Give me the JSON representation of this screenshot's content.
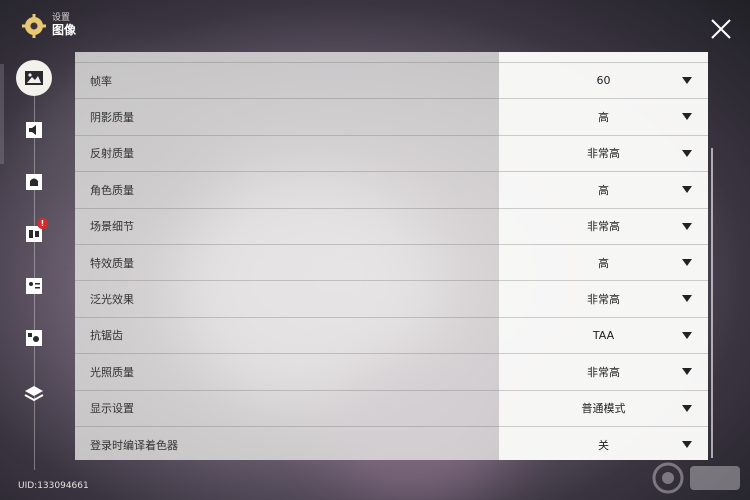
{
  "header": {
    "section": "设置",
    "title": "图像"
  },
  "nav": {
    "items": [
      {
        "id": "graphics",
        "icon": "image-icon",
        "active": true
      },
      {
        "id": "audio",
        "icon": "speaker-icon",
        "active": false
      },
      {
        "id": "notifications",
        "icon": "bell-icon",
        "active": false
      },
      {
        "id": "account",
        "icon": "account-card-icon",
        "active": false,
        "badge": "!"
      },
      {
        "id": "profile",
        "icon": "id-card-icon",
        "active": false
      },
      {
        "id": "controls",
        "icon": "gear-card-icon",
        "active": false
      },
      {
        "id": "other",
        "icon": "layers-icon",
        "active": false
      }
    ]
  },
  "settings": {
    "rows": [
      {
        "label": "帧率",
        "value": "60"
      },
      {
        "label": "阴影质量",
        "value": "高"
      },
      {
        "label": "反射质量",
        "value": "非常高"
      },
      {
        "label": "角色质量",
        "value": "高"
      },
      {
        "label": "场景细节",
        "value": "非常高"
      },
      {
        "label": "特效质量",
        "value": "高"
      },
      {
        "label": "泛光效果",
        "value": "非常高"
      },
      {
        "label": "抗锯齿",
        "value": "TAA"
      },
      {
        "label": "光照质量",
        "value": "非常高"
      },
      {
        "label": "显示设置",
        "value": "普通模式"
      },
      {
        "label": "登录时编译着色器",
        "value": "关"
      }
    ]
  },
  "footer": {
    "uid": "UID:133094661"
  },
  "colors": {
    "accent": "#f3f1ec",
    "badge": "#d22c2c",
    "text": "#333333"
  }
}
